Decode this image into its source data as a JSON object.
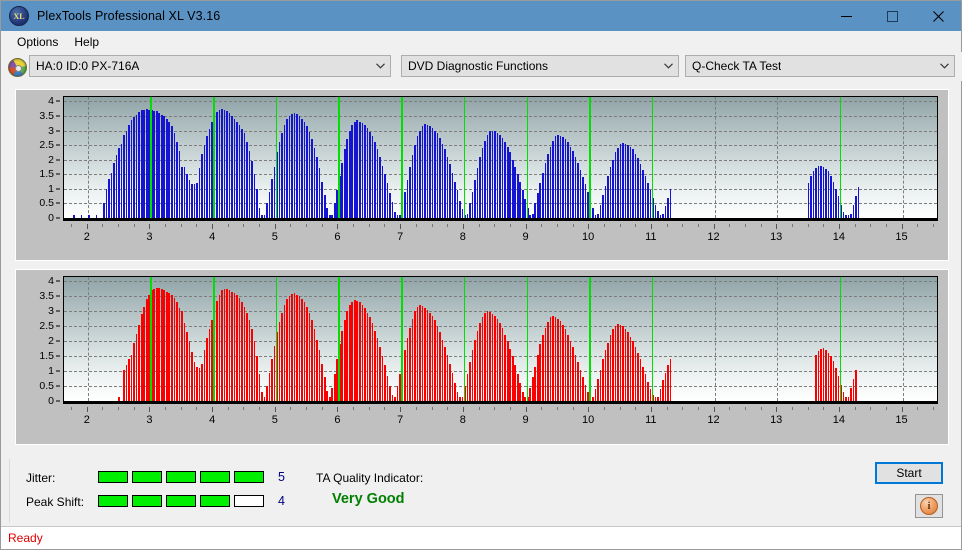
{
  "window": {
    "title": "PlexTools Professional XL V3.16",
    "icon": "xl-disc-icon",
    "minimize": "—",
    "maximize": "□",
    "close": "✕"
  },
  "menu": {
    "items": [
      "Options",
      "Help"
    ]
  },
  "toolbar": {
    "drive": {
      "icon": "optical-disc-icon",
      "value": "HA:0 ID:0  PX-716A"
    },
    "function": {
      "value": "DVD Diagnostic Functions"
    },
    "test": {
      "value": "Q-Check TA Test"
    }
  },
  "charts": {
    "y_ticks": [
      "4",
      "3.5",
      "3",
      "2.5",
      "2",
      "1.5",
      "1",
      "0.5",
      "0"
    ],
    "x_ticks": [
      "2",
      "3",
      "4",
      "5",
      "6",
      "7",
      "8",
      "9",
      "10",
      "11",
      "12",
      "13",
      "14",
      "15"
    ]
  },
  "chart_data": [
    {
      "type": "bar",
      "name": "jitter-chart",
      "title": "",
      "xlabel": "",
      "ylabel": "",
      "color": "#1414d2",
      "ylim": [
        0,
        4.15
      ],
      "xlim": [
        1.62,
        15.55
      ],
      "grid": true,
      "marker_color": "#00e000",
      "markers": [
        3,
        4,
        5,
        6,
        7,
        8,
        9,
        10,
        11,
        14
      ],
      "x": [
        1.78,
        1.9,
        2.02,
        2.14,
        2.26,
        2.3,
        2.34,
        2.38,
        2.42,
        2.46,
        2.5,
        2.54,
        2.58,
        2.62,
        2.66,
        2.7,
        2.74,
        2.78,
        2.82,
        2.86,
        2.9,
        2.94,
        2.98,
        3.02,
        3.06,
        3.1,
        3.14,
        3.18,
        3.22,
        3.26,
        3.3,
        3.34,
        3.38,
        3.42,
        3.46,
        3.5,
        3.54,
        3.58,
        3.62,
        3.66,
        3.7,
        3.74,
        3.78,
        3.82,
        3.86,
        3.9,
        3.94,
        3.98,
        4.02,
        4.06,
        4.1,
        4.14,
        4.18,
        4.22,
        4.26,
        4.3,
        4.34,
        4.38,
        4.42,
        4.46,
        4.5,
        4.54,
        4.58,
        4.62,
        4.66,
        4.7,
        4.74,
        4.78,
        4.82,
        4.86,
        4.9,
        4.94,
        4.98,
        5.02,
        5.06,
        5.1,
        5.14,
        5.18,
        5.22,
        5.26,
        5.3,
        5.34,
        5.38,
        5.42,
        5.46,
        5.5,
        5.54,
        5.58,
        5.62,
        5.66,
        5.7,
        5.74,
        5.78,
        5.82,
        5.86,
        5.9,
        5.94,
        5.98,
        6.02,
        6.06,
        6.1,
        6.14,
        6.18,
        6.22,
        6.26,
        6.3,
        6.34,
        6.38,
        6.42,
        6.46,
        6.5,
        6.54,
        6.58,
        6.62,
        6.66,
        6.7,
        6.74,
        6.78,
        6.82,
        6.86,
        6.9,
        6.94,
        6.98,
        7.02,
        7.06,
        7.1,
        7.14,
        7.18,
        7.22,
        7.26,
        7.3,
        7.34,
        7.38,
        7.42,
        7.46,
        7.5,
        7.54,
        7.58,
        7.62,
        7.66,
        7.7,
        7.74,
        7.78,
        7.82,
        7.86,
        7.9,
        7.94,
        7.98,
        8.02,
        8.06,
        8.1,
        8.14,
        8.18,
        8.22,
        8.26,
        8.3,
        8.34,
        8.38,
        8.42,
        8.46,
        8.5,
        8.54,
        8.58,
        8.62,
        8.66,
        8.7,
        8.74,
        8.78,
        8.82,
        8.86,
        8.9,
        8.94,
        8.98,
        9.02,
        9.06,
        9.1,
        9.14,
        9.18,
        9.22,
        9.26,
        9.3,
        9.34,
        9.38,
        9.42,
        9.46,
        9.5,
        9.54,
        9.58,
        9.62,
        9.66,
        9.7,
        9.74,
        9.78,
        9.82,
        9.86,
        9.9,
        9.94,
        9.98,
        10.02,
        10.06,
        10.1,
        10.14,
        10.18,
        10.22,
        10.26,
        10.3,
        10.34,
        10.38,
        10.42,
        10.46,
        10.5,
        10.54,
        10.58,
        10.62,
        10.66,
        10.7,
        10.74,
        10.78,
        10.82,
        10.86,
        10.9,
        10.94,
        10.98,
        11.02,
        11.06,
        11.1,
        11.14,
        11.18,
        11.22,
        11.26,
        11.3,
        13.5,
        13.54,
        13.58,
        13.62,
        13.66,
        13.7,
        13.74,
        13.78,
        13.82,
        13.86,
        13.9,
        13.94,
        13.98,
        14.02,
        14.06,
        14.1,
        14.14,
        14.18,
        14.22,
        14.26,
        14.3
      ],
      "values": [
        0.1,
        0.1,
        0.1,
        0.1,
        0.5,
        1.0,
        1.35,
        1.55,
        1.9,
        2.15,
        2.4,
        2.55,
        2.85,
        3.0,
        3.2,
        3.35,
        3.45,
        3.55,
        3.62,
        3.7,
        3.72,
        3.74,
        3.72,
        3.7,
        3.68,
        3.66,
        3.6,
        3.55,
        3.5,
        3.4,
        3.3,
        3.15,
        2.9,
        2.6,
        2.3,
        1.75,
        1.75,
        1.5,
        1.3,
        1.15,
        1.15,
        1.2,
        1.7,
        2.2,
        2.5,
        2.8,
        3.05,
        3.3,
        3.5,
        3.65,
        3.72,
        3.74,
        3.72,
        3.68,
        3.6,
        3.5,
        3.4,
        3.3,
        3.2,
        3.05,
        2.9,
        2.6,
        2.3,
        1.95,
        1.5,
        1.0,
        0.35,
        0.12,
        0.12,
        0.5,
        0.9,
        1.35,
        1.75,
        2.25,
        2.6,
        2.9,
        3.2,
        3.4,
        3.5,
        3.58,
        3.6,
        3.58,
        3.5,
        3.4,
        3.3,
        3.15,
        2.95,
        2.7,
        2.4,
        2.1,
        1.7,
        1.25,
        0.8,
        0.35,
        0.12,
        0.12,
        0.5,
        0.95,
        1.45,
        1.9,
        2.35,
        2.7,
        3.0,
        3.2,
        3.3,
        3.35,
        3.3,
        3.25,
        3.2,
        3.1,
        2.95,
        2.8,
        2.6,
        2.35,
        2.1,
        1.8,
        1.5,
        1.2,
        0.85,
        0.55,
        0.2,
        0.12,
        0.12,
        0.5,
        0.9,
        1.3,
        1.75,
        2.15,
        2.5,
        2.8,
        3.0,
        3.15,
        3.22,
        3.2,
        3.15,
        3.1,
        3.0,
        2.9,
        2.75,
        2.55,
        2.35,
        2.1,
        1.85,
        1.55,
        1.25,
        0.95,
        0.6,
        0.3,
        0.12,
        0.15,
        0.5,
        0.9,
        1.3,
        1.7,
        2.1,
        2.4,
        2.65,
        2.85,
        2.98,
        3.0,
        2.98,
        2.92,
        2.85,
        2.75,
        2.6,
        2.45,
        2.25,
        2.0,
        1.75,
        1.5,
        1.25,
        0.95,
        0.65,
        0.35,
        0.12,
        0.15,
        0.5,
        0.85,
        1.2,
        1.55,
        1.9,
        2.2,
        2.45,
        2.65,
        2.8,
        2.85,
        2.82,
        2.78,
        2.7,
        2.6,
        2.45,
        2.3,
        2.1,
        1.9,
        1.65,
        1.4,
        1.15,
        0.9,
        0.6,
        0.35,
        0.12,
        0.15,
        0.45,
        0.8,
        1.1,
        1.45,
        1.75,
        2.0,
        2.25,
        2.4,
        2.55,
        2.58,
        2.55,
        2.5,
        2.45,
        2.35,
        2.2,
        2.05,
        1.85,
        1.65,
        1.45,
        1.2,
        0.95,
        0.7,
        0.45,
        0.25,
        0.12,
        0.15,
        0.4,
        0.7,
        1.0,
        1.2,
        1.45,
        1.6,
        1.7,
        1.78,
        1.8,
        1.75,
        1.68,
        1.6,
        1.45,
        1.25,
        1.0,
        0.75,
        0.45,
        0.22,
        0.12,
        0.12,
        0.15,
        0.45,
        0.75,
        1.05,
        1.3,
        1.5,
        1.65,
        1.75,
        1.78,
        1.8,
        1.75,
        1.65,
        1.5,
        1.35,
        1.1,
        0.8,
        0.5,
        0.25,
        0.12
      ]
    },
    {
      "type": "bar",
      "name": "peak-shift-chart",
      "title": "",
      "xlabel": "",
      "ylabel": "",
      "color": "#fa0000",
      "ylim": [
        0,
        4.15
      ],
      "xlim": [
        1.62,
        15.55
      ],
      "grid": true,
      "marker_color": "#00e000",
      "markers": [
        3,
        4,
        5,
        6,
        7,
        8,
        9,
        10,
        11,
        14
      ],
      "x": [
        2.5,
        2.58,
        2.62,
        2.66,
        2.7,
        2.74,
        2.78,
        2.82,
        2.86,
        2.9,
        2.94,
        2.98,
        3.02,
        3.06,
        3.1,
        3.14,
        3.18,
        3.22,
        3.26,
        3.3,
        3.34,
        3.38,
        3.42,
        3.46,
        3.5,
        3.54,
        3.58,
        3.62,
        3.66,
        3.7,
        3.74,
        3.78,
        3.82,
        3.86,
        3.9,
        3.94,
        3.98,
        4.02,
        4.06,
        4.1,
        4.14,
        4.18,
        4.22,
        4.26,
        4.3,
        4.34,
        4.38,
        4.42,
        4.46,
        4.5,
        4.54,
        4.58,
        4.62,
        4.66,
        4.7,
        4.74,
        4.78,
        4.82,
        4.86,
        4.9,
        4.94,
        4.98,
        5.02,
        5.06,
        5.1,
        5.14,
        5.18,
        5.22,
        5.26,
        5.3,
        5.34,
        5.38,
        5.42,
        5.46,
        5.5,
        5.54,
        5.58,
        5.62,
        5.66,
        5.7,
        5.74,
        5.78,
        5.82,
        5.86,
        5.9,
        5.94,
        5.98,
        6.02,
        6.06,
        6.1,
        6.14,
        6.18,
        6.22,
        6.26,
        6.3,
        6.34,
        6.38,
        6.42,
        6.46,
        6.5,
        6.54,
        6.58,
        6.62,
        6.66,
        6.7,
        6.74,
        6.78,
        6.82,
        6.86,
        6.9,
        6.94,
        6.98,
        7.02,
        7.06,
        7.1,
        7.14,
        7.18,
        7.22,
        7.26,
        7.3,
        7.34,
        7.38,
        7.42,
        7.46,
        7.5,
        7.54,
        7.58,
        7.62,
        7.66,
        7.7,
        7.74,
        7.78,
        7.82,
        7.86,
        7.9,
        7.94,
        7.98,
        8.02,
        8.06,
        8.1,
        8.14,
        8.18,
        8.22,
        8.26,
        8.3,
        8.34,
        8.38,
        8.42,
        8.46,
        8.5,
        8.54,
        8.58,
        8.62,
        8.66,
        8.7,
        8.74,
        8.78,
        8.82,
        8.86,
        8.9,
        8.94,
        8.98,
        9.02,
        9.06,
        9.1,
        9.14,
        9.18,
        9.22,
        9.26,
        9.3,
        9.34,
        9.38,
        9.42,
        9.46,
        9.5,
        9.54,
        9.58,
        9.62,
        9.66,
        9.7,
        9.74,
        9.78,
        9.82,
        9.86,
        9.9,
        9.94,
        9.98,
        10.02,
        10.06,
        10.1,
        10.14,
        10.18,
        10.22,
        10.26,
        10.3,
        10.34,
        10.38,
        10.42,
        10.46,
        10.5,
        10.54,
        10.58,
        10.62,
        10.66,
        10.7,
        10.74,
        10.78,
        10.82,
        10.86,
        10.9,
        10.94,
        10.98,
        11.02,
        11.06,
        11.1,
        11.14,
        11.18,
        11.22,
        11.26,
        11.3,
        13.62,
        13.66,
        13.7,
        13.74,
        13.78,
        13.82,
        13.86,
        13.9,
        13.94,
        13.98,
        14.02,
        14.06,
        14.1,
        14.14,
        14.18,
        14.22,
        14.26
      ],
      "values": [
        0.15,
        1.05,
        1.2,
        1.4,
        1.55,
        1.95,
        2.25,
        2.55,
        2.9,
        3.15,
        3.4,
        3.55,
        3.7,
        3.75,
        3.78,
        3.78,
        3.76,
        3.72,
        3.65,
        3.6,
        3.55,
        3.45,
        3.3,
        3.1,
        3.0,
        2.6,
        2.3,
        2.0,
        1.65,
        1.3,
        1.15,
        1.1,
        1.25,
        1.7,
        2.1,
        2.4,
        2.7,
        3.05,
        3.35,
        3.55,
        3.7,
        3.75,
        3.76,
        3.72,
        3.65,
        3.6,
        3.55,
        3.45,
        3.3,
        3.15,
        2.95,
        2.7,
        2.4,
        2.0,
        1.5,
        0.9,
        0.3,
        0.15,
        0.5,
        0.95,
        1.4,
        1.85,
        2.3,
        2.65,
        2.95,
        3.2,
        3.4,
        3.52,
        3.58,
        3.6,
        3.56,
        3.5,
        3.4,
        3.3,
        3.15,
        2.95,
        2.7,
        2.4,
        2.05,
        1.7,
        1.25,
        0.8,
        0.35,
        0.15,
        0.45,
        0.9,
        1.4,
        1.9,
        2.35,
        2.7,
        3.0,
        3.2,
        3.32,
        3.38,
        3.35,
        3.3,
        3.2,
        3.1,
        2.95,
        2.8,
        2.6,
        2.35,
        2.1,
        1.8,
        1.5,
        1.2,
        0.85,
        0.5,
        0.2,
        0.15,
        0.5,
        0.9,
        1.3,
        1.7,
        2.1,
        2.45,
        2.75,
        3.0,
        3.15,
        3.2,
        3.18,
        3.12,
        3.05,
        2.95,
        2.85,
        2.7,
        2.5,
        2.3,
        2.05,
        1.8,
        1.55,
        1.25,
        0.95,
        0.6,
        0.3,
        0.15,
        0.15,
        0.5,
        0.9,
        1.3,
        1.7,
        2.05,
        2.35,
        2.6,
        2.8,
        2.95,
        3.0,
        2.98,
        2.92,
        2.85,
        2.75,
        2.6,
        2.45,
        2.2,
        2.0,
        1.75,
        1.5,
        1.2,
        0.9,
        0.6,
        0.3,
        0.15,
        0.15,
        0.45,
        0.8,
        1.15,
        1.55,
        1.9,
        2.2,
        2.45,
        2.65,
        2.8,
        2.85,
        2.82,
        2.75,
        2.68,
        2.55,
        2.4,
        2.2,
        2.0,
        1.8,
        1.55,
        1.3,
        1.05,
        0.8,
        0.55,
        0.3,
        0.15,
        0.15,
        0.4,
        0.75,
        1.05,
        1.4,
        1.7,
        1.95,
        2.2,
        2.4,
        2.5,
        2.58,
        2.55,
        2.5,
        2.42,
        2.3,
        2.15,
        2.0,
        1.8,
        1.6,
        1.4,
        1.15,
        0.9,
        0.65,
        0.4,
        0.2,
        0.12,
        0.15,
        0.4,
        0.7,
        0.95,
        1.2,
        1.4,
        1.55,
        1.68,
        1.75,
        1.78,
        1.72,
        1.62,
        1.5,
        1.35,
        1.1,
        0.85,
        0.55,
        0.3,
        0.15,
        0.15,
        0.45,
        0.75,
        1.05,
        1.3,
        1.5,
        1.65,
        1.75,
        1.8,
        1.78,
        1.7,
        1.6,
        1.45,
        1.25,
        1.0,
        0.7,
        0.35
      ]
    }
  ],
  "results": {
    "jitter": {
      "label": "Jitter:",
      "value": 5,
      "max": 5
    },
    "peak_shift": {
      "label": "Peak Shift:",
      "value": 4,
      "max": 5
    },
    "ta_quality": {
      "label": "TA Quality Indicator:",
      "value": "Very Good",
      "color": "#008000"
    }
  },
  "actions": {
    "start": "Start",
    "info": "info-icon"
  },
  "status": {
    "text": "Ready",
    "color": "#e00000"
  }
}
